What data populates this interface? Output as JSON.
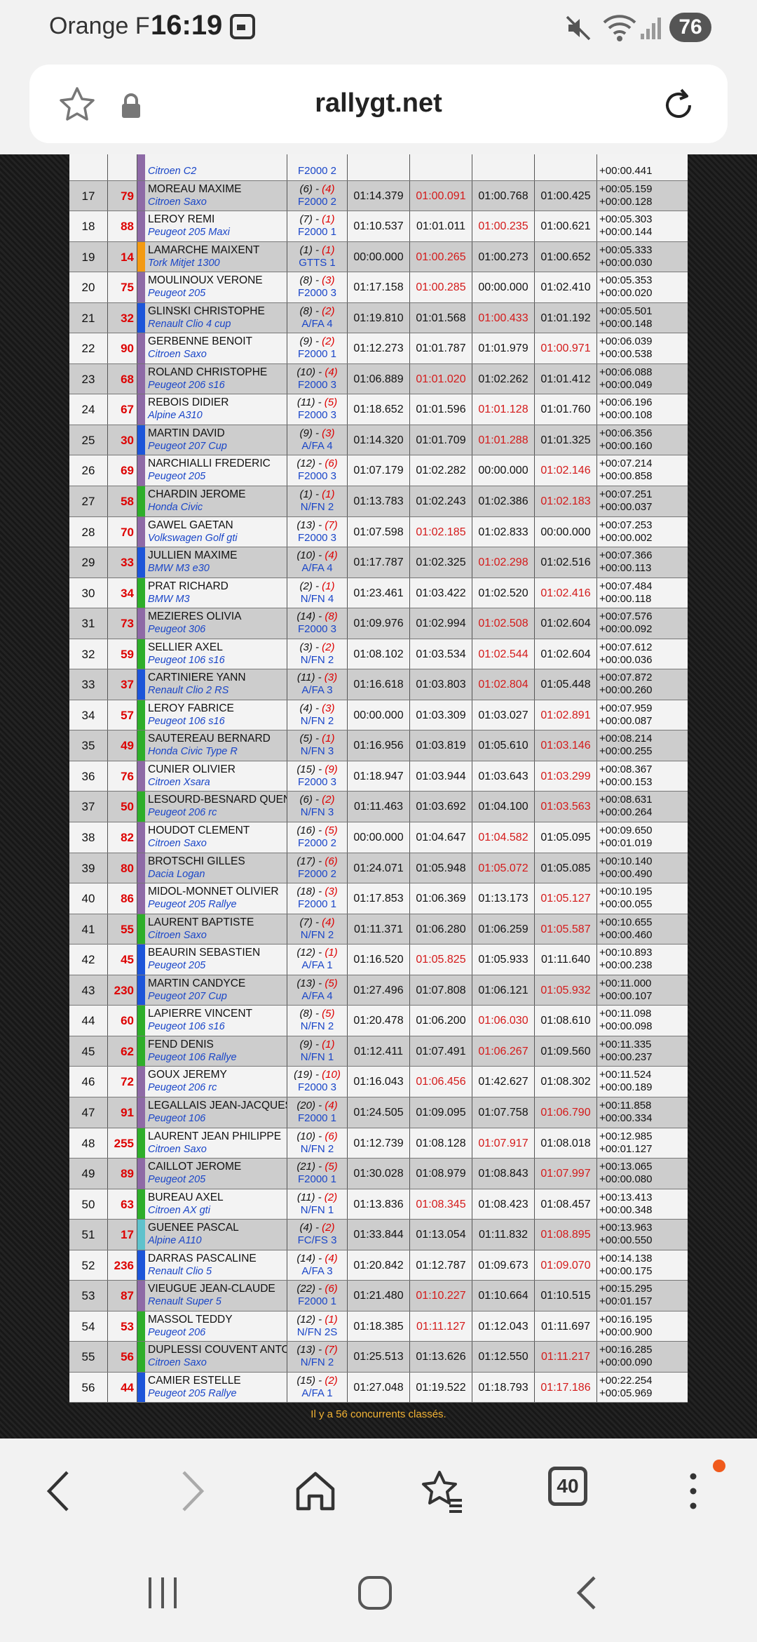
{
  "status_bar": {
    "carrier": "Orange F",
    "time": "16:19",
    "battery": "76"
  },
  "browser": {
    "host": "rallygt.net",
    "tab_count": "40"
  },
  "stripe_colors": {
    "purple": "#8e6aa6",
    "blue": "#1d55d9",
    "orange": "#f39a13",
    "green": "#2eae2a",
    "cyan": "#5fc2cc"
  },
  "partial_row": {
    "car": "Citroen C2",
    "class": "F2000 2",
    "gap": "+00:00.441"
  },
  "table": {
    "rows": [
      {
        "pos": "17",
        "num": "79",
        "stripe": "purple",
        "driver": "MOREAU MAXIME",
        "car": "Citroen Saxo",
        "place": "(6) - ",
        "class_place": "(4)",
        "class": "F2000 2",
        "t1": "01:14.379",
        "t2": "01:00.091",
        "t3": "01:00.768",
        "t4": "01:00.425",
        "best": 2,
        "gap1": "+00:05.159",
        "gap2": "+00:00.128"
      },
      {
        "pos": "18",
        "num": "88",
        "stripe": "purple",
        "driver": "LEROY REMI",
        "car": "Peugeot 205 Maxi",
        "place": "(7) - ",
        "class_place": "(1)",
        "class": "F2000 1",
        "t1": "01:10.537",
        "t2": "01:01.011",
        "t3": "01:00.235",
        "t4": "01:00.621",
        "best": 3,
        "gap1": "+00:05.303",
        "gap2": "+00:00.144"
      },
      {
        "pos": "19",
        "num": "14",
        "stripe": "orange",
        "driver": "LAMARCHE MAIXENT",
        "car": "Tork Mitjet 1300",
        "place": "(1) - ",
        "class_place": "(1)",
        "class": "GTTS 1",
        "t1": "00:00.000",
        "t2": "01:00.265",
        "t3": "01:00.273",
        "t4": "01:00.652",
        "best": 2,
        "gap1": "+00:05.333",
        "gap2": "+00:00.030"
      },
      {
        "pos": "20",
        "num": "75",
        "stripe": "purple",
        "driver": "MOULINOUX VERONE",
        "car": "Peugeot 205",
        "place": "(8) - ",
        "class_place": "(3)",
        "class": "F2000 3",
        "t1": "01:17.158",
        "t2": "01:00.285",
        "t3": "00:00.000",
        "t4": "01:02.410",
        "best": 2,
        "gap1": "+00:05.353",
        "gap2": "+00:00.020"
      },
      {
        "pos": "21",
        "num": "32",
        "stripe": "blue",
        "driver": "GLINSKI CHRISTOPHE",
        "car": "Renault Clio 4 cup",
        "place": "(8) - ",
        "class_place": "(2)",
        "class": "A/FA 4",
        "t1": "01:19.810",
        "t2": "01:01.568",
        "t3": "01:00.433",
        "t4": "01:01.192",
        "best": 3,
        "gap1": "+00:05.501",
        "gap2": "+00:00.148"
      },
      {
        "pos": "22",
        "num": "90",
        "stripe": "purple",
        "driver": "GERBENNE BENOIT",
        "car": "Citroen Saxo",
        "place": "(9) - ",
        "class_place": "(2)",
        "class": "F2000 1",
        "t1": "01:12.273",
        "t2": "01:01.787",
        "t3": "01:01.979",
        "t4": "01:00.971",
        "best": 4,
        "gap1": "+00:06.039",
        "gap2": "+00:00.538"
      },
      {
        "pos": "23",
        "num": "68",
        "stripe": "purple",
        "driver": "ROLAND CHRISTOPHE",
        "car": "Peugeot 206 s16",
        "place": "(10) - ",
        "class_place": "(4)",
        "class": "F2000 3",
        "t1": "01:06.889",
        "t2": "01:01.020",
        "t3": "01:02.262",
        "t4": "01:01.412",
        "best": 2,
        "gap1": "+00:06.088",
        "gap2": "+00:00.049"
      },
      {
        "pos": "24",
        "num": "67",
        "stripe": "purple",
        "driver": "REBOIS DIDIER",
        "car": "Alpine A310",
        "place": "(11) - ",
        "class_place": "(5)",
        "class": "F2000 3",
        "t1": "01:18.652",
        "t2": "01:01.596",
        "t3": "01:01.128",
        "t4": "01:01.760",
        "best": 3,
        "gap1": "+00:06.196",
        "gap2": "+00:00.108"
      },
      {
        "pos": "25",
        "num": "30",
        "stripe": "blue",
        "driver": "MARTIN DAVID",
        "car": "Peugeot 207 Cup",
        "place": "(9) - ",
        "class_place": "(3)",
        "class": "A/FA 4",
        "t1": "01:14.320",
        "t2": "01:01.709",
        "t3": "01:01.288",
        "t4": "01:01.325",
        "best": 3,
        "gap1": "+00:06.356",
        "gap2": "+00:00.160"
      },
      {
        "pos": "26",
        "num": "69",
        "stripe": "purple",
        "driver": "NARCHIALLI FREDERIC",
        "car": "Peugeot 205",
        "place": "(12) - ",
        "class_place": "(6)",
        "class": "F2000 3",
        "t1": "01:07.179",
        "t2": "01:02.282",
        "t3": "00:00.000",
        "t4": "01:02.146",
        "best": 4,
        "gap1": "+00:07.214",
        "gap2": "+00:00.858"
      },
      {
        "pos": "27",
        "num": "58",
        "stripe": "green",
        "driver": "CHARDIN JEROME",
        "car": "Honda Civic",
        "place": "(1) - ",
        "class_place": "(1)",
        "class": "N/FN 2",
        "t1": "01:13.783",
        "t2": "01:02.243",
        "t3": "01:02.386",
        "t4": "01:02.183",
        "best": 4,
        "gap1": "+00:07.251",
        "gap2": "+00:00.037"
      },
      {
        "pos": "28",
        "num": "70",
        "stripe": "purple",
        "driver": "GAWEL GAETAN",
        "car": "Volkswagen Golf gti",
        "place": "(13) - ",
        "class_place": "(7)",
        "class": "F2000 3",
        "t1": "01:07.598",
        "t2": "01:02.185",
        "t3": "01:02.833",
        "t4": "00:00.000",
        "best": 2,
        "gap1": "+00:07.253",
        "gap2": "+00:00.002"
      },
      {
        "pos": "29",
        "num": "33",
        "stripe": "blue",
        "driver": "JULLIEN MAXIME",
        "car": "BMW M3 e30",
        "place": "(10) - ",
        "class_place": "(4)",
        "class": "A/FA 4",
        "t1": "01:17.787",
        "t2": "01:02.325",
        "t3": "01:02.298",
        "t4": "01:02.516",
        "best": 3,
        "gap1": "+00:07.366",
        "gap2": "+00:00.113"
      },
      {
        "pos": "30",
        "num": "34",
        "stripe": "green",
        "driver": "PRAT RICHARD",
        "car": "BMW M3",
        "place": "(2) - ",
        "class_place": "(1)",
        "class": "N/FN 4",
        "t1": "01:23.461",
        "t2": "01:03.422",
        "t3": "01:02.520",
        "t4": "01:02.416",
        "best": 4,
        "gap1": "+00:07.484",
        "gap2": "+00:00.118"
      },
      {
        "pos": "31",
        "num": "73",
        "stripe": "purple",
        "driver": "MEZIERES OLIVIA",
        "car": "Peugeot 306",
        "place": "(14) - ",
        "class_place": "(8)",
        "class": "F2000 3",
        "t1": "01:09.976",
        "t2": "01:02.994",
        "t3": "01:02.508",
        "t4": "01:02.604",
        "best": 3,
        "gap1": "+00:07.576",
        "gap2": "+00:00.092"
      },
      {
        "pos": "32",
        "num": "59",
        "stripe": "green",
        "driver": "SELLIER AXEL",
        "car": "Peugeot 106 s16",
        "place": "(3) - ",
        "class_place": "(2)",
        "class": "N/FN 2",
        "t1": "01:08.102",
        "t2": "01:03.534",
        "t3": "01:02.544",
        "t4": "01:02.604",
        "best": 3,
        "gap1": "+00:07.612",
        "gap2": "+00:00.036"
      },
      {
        "pos": "33",
        "num": "37",
        "stripe": "blue",
        "driver": "CARTINIERE YANN",
        "car": "Renault Clio 2 RS",
        "place": "(11) - ",
        "class_place": "(3)",
        "class": "A/FA 3",
        "t1": "01:16.618",
        "t2": "01:03.803",
        "t3": "01:02.804",
        "t4": "01:05.448",
        "best": 3,
        "gap1": "+00:07.872",
        "gap2": "+00:00.260"
      },
      {
        "pos": "34",
        "num": "57",
        "stripe": "green",
        "driver": "LEROY FABRICE",
        "car": "Peugeot 106 s16",
        "place": "(4) - ",
        "class_place": "(3)",
        "class": "N/FN 2",
        "t1": "00:00.000",
        "t2": "01:03.309",
        "t3": "01:03.027",
        "t4": "01:02.891",
        "best": 4,
        "gap1": "+00:07.959",
        "gap2": "+00:00.087"
      },
      {
        "pos": "35",
        "num": "49",
        "stripe": "green",
        "driver": "SAUTEREAU BERNARD",
        "car": "Honda Civic Type R",
        "place": "(5) - ",
        "class_place": "(1)",
        "class": "N/FN 3",
        "t1": "01:16.956",
        "t2": "01:03.819",
        "t3": "01:05.610",
        "t4": "01:03.146",
        "best": 4,
        "gap1": "+00:08.214",
        "gap2": "+00:00.255"
      },
      {
        "pos": "36",
        "num": "76",
        "stripe": "purple",
        "driver": "CUNIER OLIVIER",
        "car": "Citroen Xsara",
        "place": "(15) - ",
        "class_place": "(9)",
        "class": "F2000 3",
        "t1": "01:18.947",
        "t2": "01:03.944",
        "t3": "01:03.643",
        "t4": "01:03.299",
        "best": 4,
        "gap1": "+00:08.367",
        "gap2": "+00:00.153"
      },
      {
        "pos": "37",
        "num": "50",
        "stripe": "green",
        "driver": "LESOURD-BESNARD QUENTIN",
        "car": "Peugeot 206 rc",
        "place": "(6) - ",
        "class_place": "(2)",
        "class": "N/FN 3",
        "t1": "01:11.463",
        "t2": "01:03.692",
        "t3": "01:04.100",
        "t4": "01:03.563",
        "best": 4,
        "gap1": "+00:08.631",
        "gap2": "+00:00.264"
      },
      {
        "pos": "38",
        "num": "82",
        "stripe": "purple",
        "driver": "HOUDOT CLEMENT",
        "car": "Citroen Saxo",
        "place": "(16) - ",
        "class_place": "(5)",
        "class": "F2000 2",
        "t1": "00:00.000",
        "t2": "01:04.647",
        "t3": "01:04.582",
        "t4": "01:05.095",
        "best": 3,
        "gap1": "+00:09.650",
        "gap2": "+00:01.019"
      },
      {
        "pos": "39",
        "num": "80",
        "stripe": "purple",
        "driver": "BROTSCHI GILLES",
        "car": "Dacia Logan",
        "place": "(17) - ",
        "class_place": "(6)",
        "class": "F2000 2",
        "t1": "01:24.071",
        "t2": "01:05.948",
        "t3": "01:05.072",
        "t4": "01:05.085",
        "best": 3,
        "gap1": "+00:10.140",
        "gap2": "+00:00.490"
      },
      {
        "pos": "40",
        "num": "86",
        "stripe": "purple",
        "driver": "MIDOL-MONNET OLIVIER",
        "car": "Peugeot 205 Rallye",
        "place": "(18) - ",
        "class_place": "(3)",
        "class": "F2000 1",
        "t1": "01:17.853",
        "t2": "01:06.369",
        "t3": "01:13.173",
        "t4": "01:05.127",
        "best": 4,
        "gap1": "+00:10.195",
        "gap2": "+00:00.055"
      },
      {
        "pos": "41",
        "num": "55",
        "stripe": "green",
        "driver": "LAURENT BAPTISTE",
        "car": "Citroen Saxo",
        "place": "(7) - ",
        "class_place": "(4)",
        "class": "N/FN 2",
        "t1": "01:11.371",
        "t2": "01:06.280",
        "t3": "01:06.259",
        "t4": "01:05.587",
        "best": 4,
        "gap1": "+00:10.655",
        "gap2": "+00:00.460"
      },
      {
        "pos": "42",
        "num": "45",
        "stripe": "blue",
        "driver": "BEAURIN SEBASTIEN",
        "car": "Peugeot 205",
        "place": "(12) - ",
        "class_place": "(1)",
        "class": "A/FA 1",
        "t1": "01:16.520",
        "t2": "01:05.825",
        "t3": "01:05.933",
        "t4": "01:11.640",
        "best": 2,
        "gap1": "+00:10.893",
        "gap2": "+00:00.238"
      },
      {
        "pos": "43",
        "num": "230",
        "stripe": "blue",
        "driver": "MARTIN CANDYCE",
        "car": "Peugeot 207 Cup",
        "place": "(13) - ",
        "class_place": "(5)",
        "class": "A/FA 4",
        "t1": "01:27.496",
        "t2": "01:07.808",
        "t3": "01:06.121",
        "t4": "01:05.932",
        "best": 4,
        "gap1": "+00:11.000",
        "gap2": "+00:00.107"
      },
      {
        "pos": "44",
        "num": "60",
        "stripe": "green",
        "driver": "LAPIERRE VINCENT",
        "car": "Peugeot 106 s16",
        "place": "(8) - ",
        "class_place": "(5)",
        "class": "N/FN 2",
        "t1": "01:20.478",
        "t2": "01:06.200",
        "t3": "01:06.030",
        "t4": "01:08.610",
        "best": 3,
        "gap1": "+00:11.098",
        "gap2": "+00:00.098"
      },
      {
        "pos": "45",
        "num": "62",
        "stripe": "green",
        "driver": "FEND DENIS",
        "car": "Peugeot 106 Rallye",
        "place": "(9) - ",
        "class_place": "(1)",
        "class": "N/FN 1",
        "t1": "01:12.411",
        "t2": "01:07.491",
        "t3": "01:06.267",
        "t4": "01:09.560",
        "best": 3,
        "gap1": "+00:11.335",
        "gap2": "+00:00.237"
      },
      {
        "pos": "46",
        "num": "72",
        "stripe": "purple",
        "driver": "GOUX JEREMY",
        "car": "Peugeot 206 rc",
        "place": "(19) - ",
        "class_place": "(10)",
        "class": "F2000 3",
        "t1": "01:16.043",
        "t2": "01:06.456",
        "t3": "01:42.627",
        "t4": "01:08.302",
        "best": 2,
        "gap1": "+00:11.524",
        "gap2": "+00:00.189"
      },
      {
        "pos": "47",
        "num": "91",
        "stripe": "purple",
        "driver": "LEGALLAIS JEAN-JACQUES",
        "car": "Peugeot 106",
        "place": "(20) - ",
        "class_place": "(4)",
        "class": "F2000 1",
        "t1": "01:24.505",
        "t2": "01:09.095",
        "t3": "01:07.758",
        "t4": "01:06.790",
        "best": 4,
        "gap1": "+00:11.858",
        "gap2": "+00:00.334"
      },
      {
        "pos": "48",
        "num": "255",
        "stripe": "green",
        "driver": "LAURENT JEAN PHILIPPE",
        "car": "Citroen Saxo",
        "place": "(10) - ",
        "class_place": "(6)",
        "class": "N/FN 2",
        "t1": "01:12.739",
        "t2": "01:08.128",
        "t3": "01:07.917",
        "t4": "01:08.018",
        "best": 3,
        "gap1": "+00:12.985",
        "gap2": "+00:01.127"
      },
      {
        "pos": "49",
        "num": "89",
        "stripe": "purple",
        "driver": "CAILLOT JEROME",
        "car": "Peugeot 205",
        "place": "(21) - ",
        "class_place": "(5)",
        "class": "F2000 1",
        "t1": "01:30.028",
        "t2": "01:08.979",
        "t3": "01:08.843",
        "t4": "01:07.997",
        "best": 4,
        "gap1": "+00:13.065",
        "gap2": "+00:00.080"
      },
      {
        "pos": "50",
        "num": "63",
        "stripe": "green",
        "driver": "BUREAU AXEL",
        "car": "Citroen AX gti",
        "place": "(11) - ",
        "class_place": "(2)",
        "class": "N/FN 1",
        "t1": "01:13.836",
        "t2": "01:08.345",
        "t3": "01:08.423",
        "t4": "01:08.457",
        "best": 2,
        "gap1": "+00:13.413",
        "gap2": "+00:00.348"
      },
      {
        "pos": "51",
        "num": "17",
        "stripe": "cyan",
        "driver": "GUENEE PASCAL",
        "car": "Alpine A110",
        "place": "(4) - ",
        "class_place": "(2)",
        "class": "FC/FS 3",
        "t1": "01:33.844",
        "t2": "01:13.054",
        "t3": "01:11.832",
        "t4": "01:08.895",
        "best": 4,
        "gap1": "+00:13.963",
        "gap2": "+00:00.550"
      },
      {
        "pos": "52",
        "num": "236",
        "stripe": "blue",
        "driver": "DARRAS PASCALINE",
        "car": "Renault Clio 5",
        "place": "(14) - ",
        "class_place": "(4)",
        "class": "A/FA 3",
        "t1": "01:20.842",
        "t2": "01:12.787",
        "t3": "01:09.673",
        "t4": "01:09.070",
        "best": 4,
        "gap1": "+00:14.138",
        "gap2": "+00:00.175"
      },
      {
        "pos": "53",
        "num": "87",
        "stripe": "purple",
        "driver": "VIEUGUE JEAN-CLAUDE",
        "car": "Renault Super 5",
        "place": "(22) - ",
        "class_place": "(6)",
        "class": "F2000 1",
        "t1": "01:21.480",
        "t2": "01:10.227",
        "t3": "01:10.664",
        "t4": "01:10.515",
        "best": 2,
        "gap1": "+00:15.295",
        "gap2": "+00:01.157"
      },
      {
        "pos": "54",
        "num": "53",
        "stripe": "green",
        "driver": "MASSOL TEDDY",
        "car": "Peugeot 206",
        "place": "(12) - ",
        "class_place": "(1)",
        "class": "N/FN 2S",
        "t1": "01:18.385",
        "t2": "01:11.127",
        "t3": "01:12.043",
        "t4": "01:11.697",
        "best": 2,
        "gap1": "+00:16.195",
        "gap2": "+00:00.900"
      },
      {
        "pos": "55",
        "num": "56",
        "stripe": "green",
        "driver": "DUPLESSI COUVENT ANTOINE",
        "car": "Citroen Saxo",
        "place": "(13) - ",
        "class_place": "(7)",
        "class": "N/FN 2",
        "t1": "01:25.513",
        "t2": "01:13.626",
        "t3": "01:12.550",
        "t4": "01:11.217",
        "best": 4,
        "gap1": "+00:16.285",
        "gap2": "+00:00.090"
      },
      {
        "pos": "56",
        "num": "44",
        "stripe": "blue",
        "driver": "CAMIER ESTELLE",
        "car": "Peugeot 205 Rallye",
        "place": "(15) - ",
        "class_place": "(2)",
        "class": "A/FA 1",
        "t1": "01:27.048",
        "t2": "01:19.522",
        "t3": "01:18.793",
        "t4": "01:17.186",
        "best": 4,
        "gap1": "+00:22.254",
        "gap2": "+00:05.969"
      }
    ]
  },
  "footer": {
    "count_before": "Il y a ",
    "count": "56",
    "count_after": " concurrents classés."
  }
}
